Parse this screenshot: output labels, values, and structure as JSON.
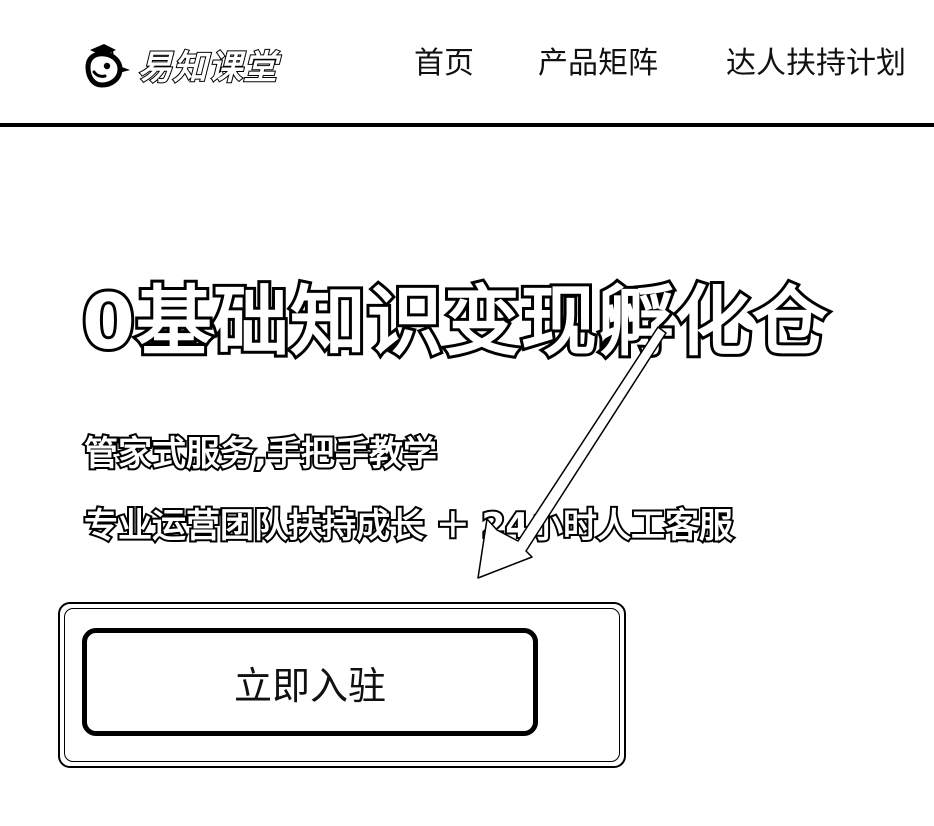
{
  "header": {
    "logo_text": "易知课堂",
    "nav": [
      "首页",
      "产品矩阵",
      "达人扶持计划"
    ]
  },
  "hero": {
    "title": "0基础知识变现孵化仓",
    "subtitle_1": "管家式服务,手把手教学",
    "subtitle_2": "专业运营团队扶持成长 ＋ 24小时人工客服",
    "cta_label": "立即入驻"
  },
  "icons": {
    "logo": "graduation-cap-bird-icon",
    "annotation": "arrow-annotation-icon"
  },
  "colors": {
    "text": "#000000",
    "background": "#ffffff"
  }
}
